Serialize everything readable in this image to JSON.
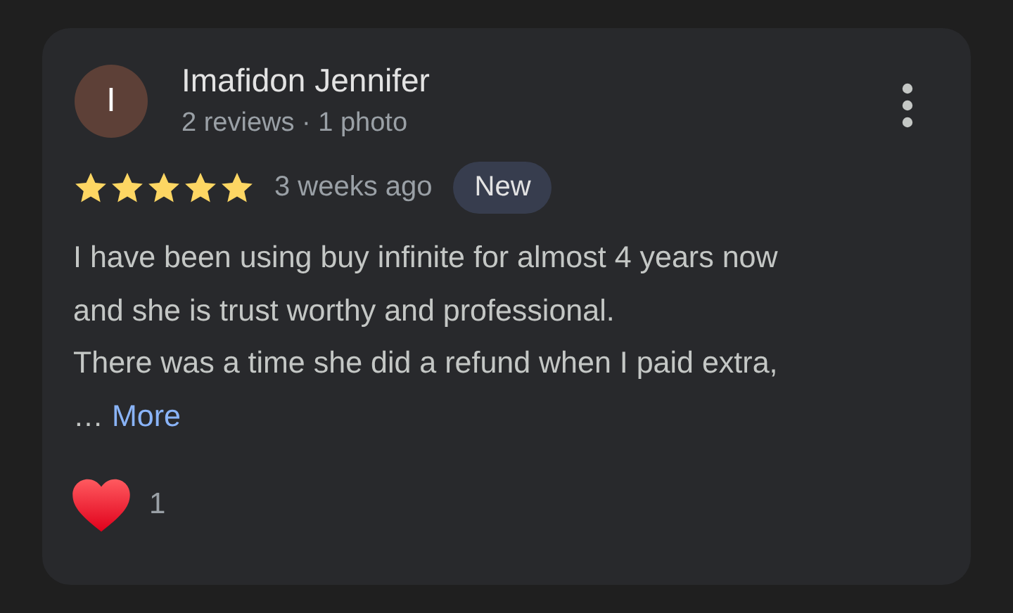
{
  "review": {
    "avatar_letter": "I",
    "author": "Imafidon Jennifer",
    "author_meta": "2 reviews · 1 photo",
    "stars": 5,
    "time": "3 weeks ago",
    "badge": "New",
    "lines": [
      "I have been using buy infinite for almost 4 years now",
      "and she is trust worthy and professional.",
      "There was a time she did a refund when I paid extra,"
    ],
    "ellipsis": "…",
    "more": "More",
    "likes": "1",
    "liked": true
  }
}
